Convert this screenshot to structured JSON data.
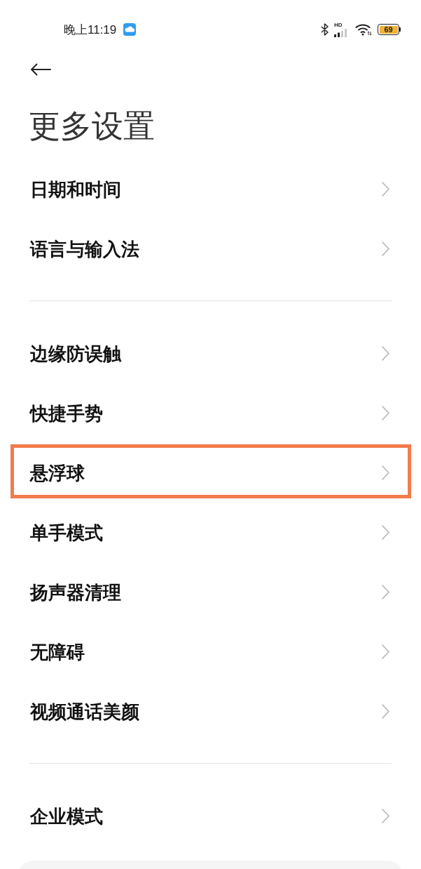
{
  "status_bar": {
    "time": "晚上11:19",
    "network_type": "HD",
    "battery": "69"
  },
  "title": "更多设置",
  "sections": [
    {
      "items": [
        {
          "label": "日期和时间",
          "highlighted": false
        },
        {
          "label": "语言与输入法",
          "highlighted": false
        }
      ]
    },
    {
      "items": [
        {
          "label": "边缘防误触",
          "highlighted": false
        },
        {
          "label": "快捷手势",
          "highlighted": false
        },
        {
          "label": "悬浮球",
          "highlighted": true
        },
        {
          "label": "单手模式",
          "highlighted": false
        },
        {
          "label": "扬声器清理",
          "highlighted": false
        },
        {
          "label": "无障碍",
          "highlighted": false
        },
        {
          "label": "视频通话美颜",
          "highlighted": false
        }
      ]
    },
    {
      "items": [
        {
          "label": "企业模式",
          "highlighted": false
        }
      ]
    }
  ]
}
